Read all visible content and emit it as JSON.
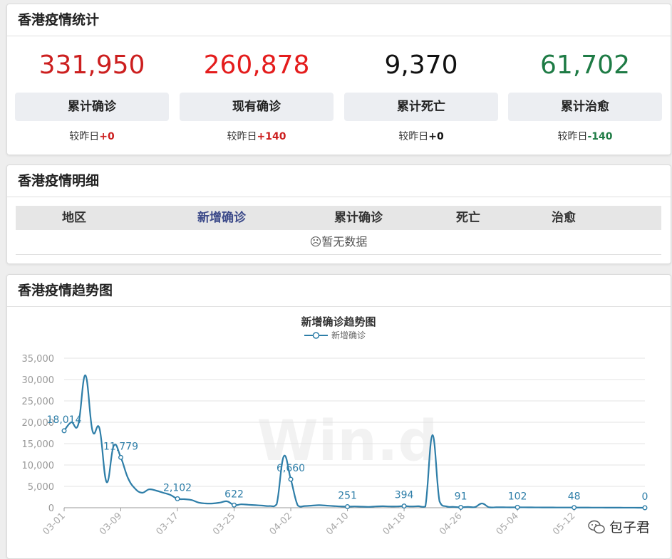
{
  "summary": {
    "title": "香港疫情统计",
    "stats": [
      {
        "value": "331,950",
        "label": "累计确诊",
        "delta_prefix": "较昨日",
        "delta": "+0",
        "color": "#cc1f1f",
        "delta_color": "#cc1f1f"
      },
      {
        "value": "260,878",
        "label": "现有确诊",
        "delta_prefix": "较昨日",
        "delta": "+140",
        "color": "#e41c1c",
        "delta_color": "#cc1f1f"
      },
      {
        "value": "9,370",
        "label": "累计死亡",
        "delta_prefix": "较昨日",
        "delta": "+0",
        "color": "#111111",
        "delta_color": "#111111"
      },
      {
        "value": "61,702",
        "label": "累计治愈",
        "delta_prefix": "较昨日",
        "delta": "-140",
        "color": "#1e7b45",
        "delta_color": "#1e7b45"
      }
    ]
  },
  "detail": {
    "title": "香港疫情明细",
    "columns": [
      "地区",
      "新增确诊",
      "累计确诊",
      "死亡",
      "治愈"
    ],
    "empty_text": "☹暂无数据"
  },
  "trend": {
    "title": "香港疫情趋势图",
    "watermark": "Win.d",
    "logo_text": "包子君"
  },
  "chart_data": {
    "type": "line",
    "title": "新增确诊趋势图",
    "series": [
      {
        "name": "新增确诊",
        "color": "#2e7ea8"
      }
    ],
    "ylim": [
      0,
      35000
    ],
    "yticks": [
      "0",
      "5,000",
      "10,000",
      "15,000",
      "20,000",
      "25,000",
      "30,000",
      "35,000"
    ],
    "xticks": [
      "03-01",
      "03-09",
      "03-17",
      "03-25",
      "04-02",
      "04-10",
      "04-18",
      "04-26",
      "05-04",
      "05-12"
    ],
    "x": [
      "03-01",
      "03-02",
      "03-03",
      "03-04",
      "03-05",
      "03-06",
      "03-07",
      "03-08",
      "03-09",
      "03-10",
      "03-11",
      "03-12",
      "03-13",
      "03-14",
      "03-15",
      "03-16",
      "03-17",
      "03-18",
      "03-19",
      "03-20",
      "03-21",
      "03-22",
      "03-23",
      "03-24",
      "03-25",
      "03-26",
      "03-27",
      "03-28",
      "03-29",
      "03-30",
      "03-31",
      "04-01",
      "04-02",
      "04-03",
      "04-04",
      "04-05",
      "04-06",
      "04-07",
      "04-08",
      "04-09",
      "04-10",
      "04-11",
      "04-12",
      "04-13",
      "04-14",
      "04-15",
      "04-16",
      "04-17",
      "04-18",
      "04-19",
      "04-20",
      "04-21",
      "04-22",
      "04-23",
      "04-24",
      "04-25",
      "04-26",
      "04-27",
      "04-28",
      "04-29",
      "04-30",
      "05-01",
      "05-02",
      "05-03",
      "05-04",
      "05-05",
      "05-06",
      "05-07",
      "05-08",
      "05-09",
      "05-10",
      "05-11",
      "05-12",
      "05-13",
      "05-14",
      "05-15",
      "05-16",
      "05-17",
      "05-18",
      "05-19",
      "05-20",
      "05-21",
      "05-22"
    ],
    "values": [
      18014,
      20000,
      19500,
      31000,
      18000,
      18500,
      6000,
      14500,
      11779,
      7000,
      4500,
      3500,
      4300,
      4000,
      3500,
      3000,
      2102,
      2000,
      1800,
      1200,
      1000,
      1000,
      1200,
      1500,
      622,
      800,
      700,
      600,
      500,
      400,
      800,
      12000,
      6660,
      500,
      400,
      500,
      600,
      500,
      400,
      300,
      251,
      300,
      250,
      200,
      300,
      350,
      300,
      300,
      394,
      300,
      350,
      300,
      17000,
      1500,
      300,
      200,
      91,
      200,
      150,
      1000,
      100,
      100,
      100,
      80,
      102,
      90,
      80,
      70,
      60,
      60,
      50,
      50,
      48,
      40,
      40,
      30,
      30,
      20,
      20,
      10,
      10,
      5,
      0
    ],
    "labels": [
      {
        "x": "03-01",
        "text": "18,014"
      },
      {
        "x": "03-09",
        "text": "11,779"
      },
      {
        "x": "03-17",
        "text": "2,102"
      },
      {
        "x": "03-25",
        "text": "622"
      },
      {
        "x": "04-02",
        "text": "6,660"
      },
      {
        "x": "04-10",
        "text": "251"
      },
      {
        "x": "04-18",
        "text": "394"
      },
      {
        "x": "04-26",
        "text": "91"
      },
      {
        "x": "05-04",
        "text": "102"
      },
      {
        "x": "05-12",
        "text": "48"
      },
      {
        "x": "05-22",
        "text": "0"
      }
    ],
    "grid": true,
    "legend_position": "top-center"
  }
}
